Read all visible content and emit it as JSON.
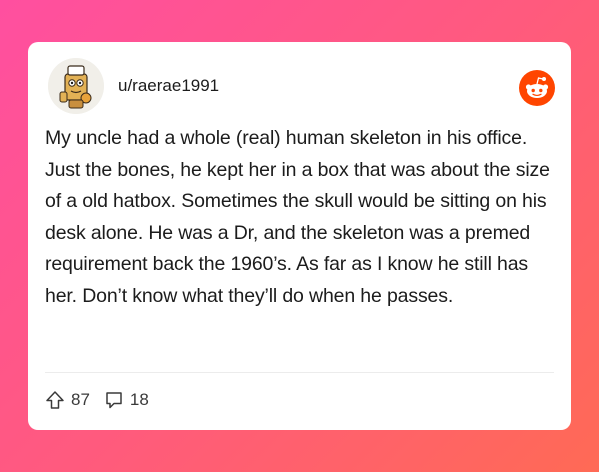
{
  "post": {
    "username": "u/raerae1991",
    "body": "My uncle had a whole (real) human skeleton in his office. Just the bones, he kept her in a box that was about the size of a old hatbox. Sometimes the skull would be sitting on his desk alone. He was a Dr, and the skeleton was a premed requirement back the 1960’s. As far as I know he still has her. Don’t know what they’ll do when he passes.",
    "upvotes": "87",
    "comments": "18"
  },
  "colors": {
    "background_start": "#ff4fa0",
    "background_end": "#ff6a55",
    "reddit_orange": "#ff4500",
    "card": "#ffffff"
  },
  "icons": {
    "avatar": "snoo-avatar-icon",
    "brand": "reddit-logo-icon",
    "upvote": "upvote-arrow-icon",
    "comment": "comment-bubble-icon"
  }
}
